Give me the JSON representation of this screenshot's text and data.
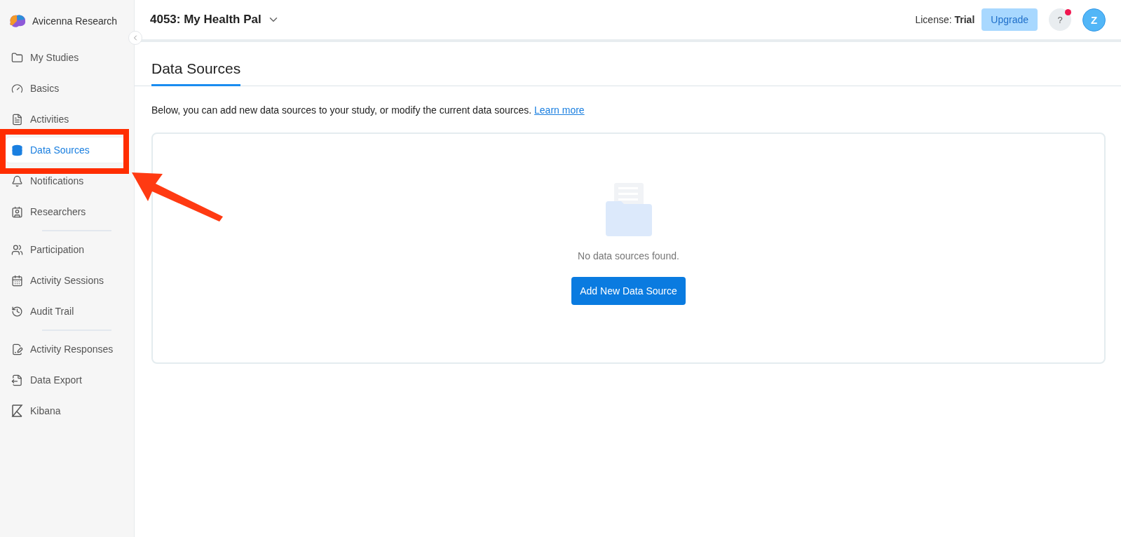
{
  "sidebar": {
    "brand": "Avicenna Research",
    "groups": [
      {
        "items": [
          {
            "label": "My Studies",
            "selected": false
          },
          {
            "label": "Basics",
            "selected": false
          },
          {
            "label": "Activities",
            "selected": false
          },
          {
            "label": "Data Sources",
            "selected": true
          },
          {
            "label": "Notifications",
            "selected": false
          },
          {
            "label": "Researchers",
            "selected": false
          }
        ]
      },
      {
        "items": [
          {
            "label": "Participation",
            "selected": false
          },
          {
            "label": "Activity Sessions",
            "selected": false
          },
          {
            "label": "Audit Trail",
            "selected": false
          }
        ]
      },
      {
        "items": [
          {
            "label": "Activity Responses",
            "selected": false
          },
          {
            "label": "Data Export",
            "selected": false
          },
          {
            "label": "Kibana",
            "selected": false
          }
        ]
      }
    ]
  },
  "header": {
    "study": "4053: My Health Pal",
    "license_label": "License:",
    "license_value": "Trial",
    "upgrade": "Upgrade",
    "help": "?",
    "help_notification": true,
    "avatar": "Z"
  },
  "tabs": [
    {
      "label": "Data Sources",
      "selected": true
    }
  ],
  "description": "Below, you can add new data sources to your study, or modify the current data sources.",
  "learn_more": "Learn more",
  "empty_state": {
    "message": "No data sources found.",
    "button": "Add New Data Source"
  }
}
